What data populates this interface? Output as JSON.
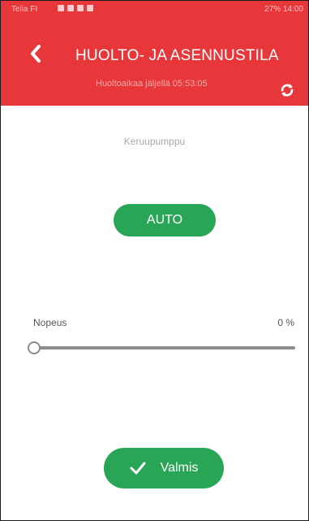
{
  "status_bar": {
    "left_text": "Telia FI",
    "right_text": "27% 14:00"
  },
  "header": {
    "title": "HUOLTO- JA ASENNUSTILA",
    "subtitle": "Huoltoaikaa jäljellä 05:53:05",
    "back_icon": "chevron-left-icon",
    "refresh_icon": "refresh-icon"
  },
  "main": {
    "device_label": "Keruupumppu",
    "mode_button_label": "AUTO",
    "speed": {
      "label": "Nopeus",
      "value_text": "0 %",
      "value_fraction": 0
    },
    "ready_button": {
      "label": "Valmis",
      "icon": "check-icon"
    }
  },
  "colors": {
    "header": "#e7373b",
    "accent_green": "#28a555",
    "text_gray": "#555555",
    "muted_gray": "#a8a8a8"
  }
}
